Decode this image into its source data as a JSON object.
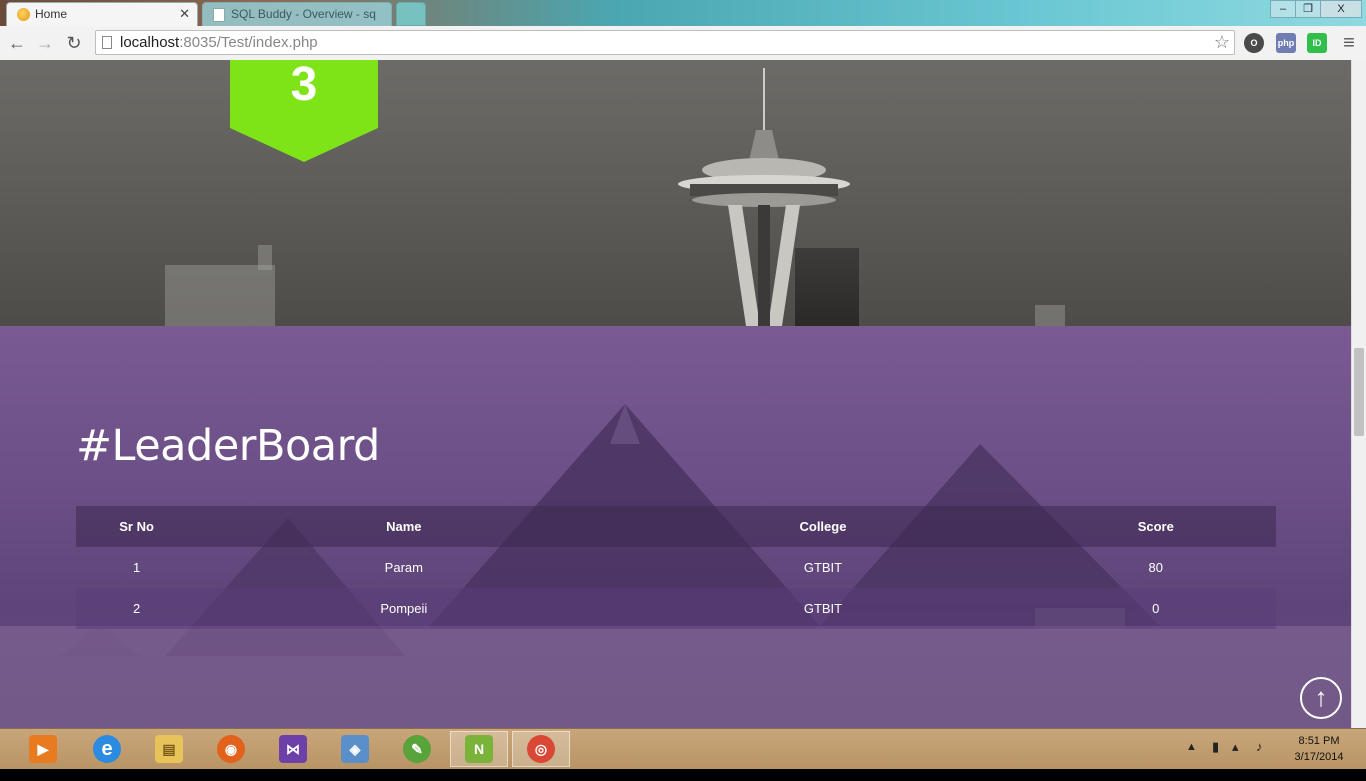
{
  "browser": {
    "tabs": [
      {
        "title": "Home",
        "active": true
      },
      {
        "title": "SQL Buddy - Overview - sq",
        "active": false
      }
    ],
    "window_controls": {
      "minimize": "‒",
      "maximize": "❐",
      "close": "X"
    },
    "nav": {
      "back": "←",
      "forward": "→",
      "reload": "↻"
    },
    "url": {
      "host": "localhost",
      "port": ":8035",
      "path": "/Test/index.php"
    },
    "bookmark_star": "☆",
    "extensions": [
      {
        "name": "opera-icon",
        "label": "O",
        "color": "#4a4a4a"
      },
      {
        "name": "php-icon",
        "label": "php",
        "color": "#6f7db3"
      },
      {
        "name": "id-icon",
        "label": "ID",
        "color": "#2fbf4a"
      }
    ],
    "menu": "≡"
  },
  "page": {
    "badge_label": "3",
    "badge_color": "#7ee317",
    "leaderboard": {
      "title": "#LeaderBoard",
      "columns": [
        "Sr No",
        "Name",
        "College",
        "Score"
      ],
      "rows": [
        {
          "sr": "1",
          "name": "Param",
          "college": "GTBIT",
          "score": "80"
        },
        {
          "sr": "2",
          "name": "Pompeii",
          "college": "GTBIT",
          "score": "0"
        }
      ]
    },
    "back_to_top": "↑"
  },
  "taskbar": {
    "apps": [
      {
        "name": "media-player-icon",
        "color": "#e87a1f",
        "glyph": "▶"
      },
      {
        "name": "internet-explorer-icon",
        "color": "#2a8be0",
        "glyph": "e"
      },
      {
        "name": "file-explorer-icon",
        "color": "#e8c35a",
        "glyph": "▤"
      },
      {
        "name": "firefox-icon",
        "color": "#e2621b",
        "glyph": "◉"
      },
      {
        "name": "visual-studio-icon",
        "color": "#6d3fa8",
        "glyph": "⋈"
      },
      {
        "name": "virtualbox-icon",
        "color": "#5b8fc9",
        "glyph": "◈"
      },
      {
        "name": "evernote-icon",
        "color": "#58a33a",
        "glyph": "✎"
      },
      {
        "name": "notepad-plus-icon",
        "color": "#7bb33a",
        "glyph": "N"
      },
      {
        "name": "chrome-icon",
        "color": "#d94735",
        "glyph": "◎"
      }
    ],
    "clock": {
      "time": "8:51 PM",
      "date": "3/17/2014"
    }
  }
}
